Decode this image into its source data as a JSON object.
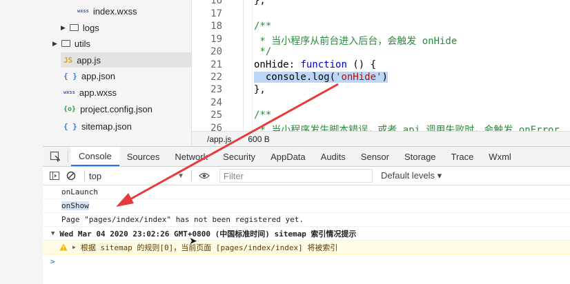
{
  "filetree": {
    "items": [
      {
        "icon": "wxss",
        "label": "index.wxss"
      },
      {
        "icon": "folder",
        "label": "logs"
      },
      {
        "icon": "folder",
        "label": "utils"
      },
      {
        "icon": "js",
        "label": "app.js"
      },
      {
        "icon": "json",
        "label": "app.json"
      },
      {
        "icon": "wxss",
        "label": "app.wxss"
      },
      {
        "icon": "config",
        "label": "project.config.json"
      },
      {
        "icon": "json",
        "label": "sitemap.json"
      }
    ],
    "icons": {
      "wxss": "wxss",
      "js": "JS",
      "json": "{ }",
      "config": "{o}"
    }
  },
  "editor": {
    "line_numbers": [
      "16",
      "17",
      "18",
      "19",
      "20",
      "21",
      "22",
      "23",
      "24",
      "25",
      "26"
    ],
    "lines": {
      "l16": "},",
      "l18": "/**",
      "l19": " * 当小程序从前台进入后台，会触发 onHide",
      "l20": " */",
      "l21_name": "onHide: ",
      "l21_kw": "function",
      "l21_rest": " () {",
      "l22_pre": "  console.log(",
      "l22_str": "'onHide'",
      "l22_post": ")",
      "l23": "},",
      "l25": "/**",
      "l26": " * 当小程序发生脚本错误，或者 api 调用失败时，会触发 onError"
    }
  },
  "statusbar": {
    "path": "/app.js",
    "size": "600 B"
  },
  "devtools": {
    "tabs": [
      "Console",
      "Sources",
      "Network",
      "Security",
      "AppData",
      "Audits",
      "Sensor",
      "Storage",
      "Trace",
      "Wxml"
    ],
    "active_tab": "Console",
    "context": "top",
    "filter_placeholder": "Filter",
    "levels": "Default levels ▾"
  },
  "console": {
    "messages": [
      "onLaunch",
      "onShow",
      "Page \"pages/index/index\" has not been registered yet."
    ],
    "group_header": "Wed Mar 04 2020 23:02:26 GMT+0800 (中国标准时间) sitemap 索引情况提示",
    "warning": "根据 sitemap 的规则[0]，当前页面 [pages/index/index] 将被索引",
    "prompt": ">"
  },
  "colors": {
    "annotation_arrow": "#e63b3b",
    "accent": "#1a73e8",
    "warning_bg": "#fffbe5"
  }
}
